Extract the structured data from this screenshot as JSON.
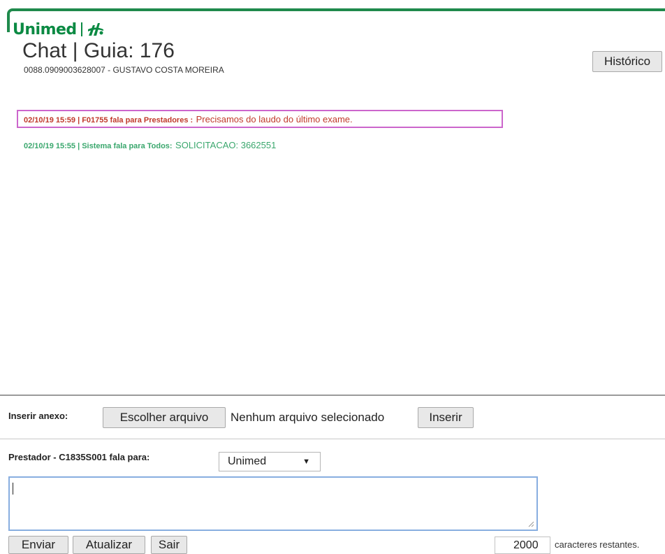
{
  "brand": {
    "name": "Unimed"
  },
  "header": {
    "title": "Chat | Guia: 176",
    "beneficiary": "0088.0909003628007 - GUSTAVO COSTA MOREIRA",
    "historico_label": "Histórico"
  },
  "messages": [
    {
      "meta": "02/10/19 15:59 | F01755 fala para Prestadores :",
      "text": "Precisamos do laudo do último exame.",
      "color": "#c0392b",
      "highlighted": true
    },
    {
      "meta": "02/10/19 15:55 | Sistema fala para Todos:",
      "text": "SOLICITACAO: 3662551",
      "color": "#3aa76d",
      "highlighted": false
    }
  ],
  "attachment": {
    "label": "Inserir anexo:",
    "choose_label": "Escolher arquivo",
    "status": "Nenhum arquivo selecionado",
    "insert_label": "Inserir"
  },
  "composer": {
    "speaker_label": "Prestador - C1835S001 fala para:",
    "recipient": "Unimed",
    "message_value": "",
    "send_label": "Enviar",
    "refresh_label": "Atualizar",
    "exit_label": "Sair",
    "remaining": "2000",
    "remaining_label": "caracteres restantes."
  },
  "colors": {
    "brand_green": "#0b8a43",
    "frame_green": "#1f8a4c"
  }
}
